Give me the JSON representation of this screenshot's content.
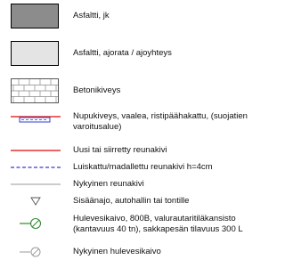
{
  "legend": {
    "items": [
      {
        "label": "Asfaltti, jk",
        "symbol": "dark-gray-fill-swatch",
        "color": "#8c8c8c"
      },
      {
        "label": "Asfaltti, ajorata / ajoyhteys",
        "symbol": "light-gray-fill-swatch",
        "color": "#e4e4e4"
      },
      {
        "label": "Betonikiveys",
        "symbol": "brick-pattern-swatch",
        "color": "#555555"
      },
      {
        "label_lines": [
          "Nupukiveys, vaalea, ristipäähakattu, (suojatien",
          "varoitusalue)"
        ],
        "symbol": "cobble-strip",
        "color": "#3b4fd6"
      },
      {
        "label": "Uusi tai siirretty reunakivi",
        "symbol": "red-solid-line",
        "color": "#e8312f"
      },
      {
        "label": "Luiskattu/madallettu reunakivi h=4cm",
        "symbol": "blue-dashed-line",
        "color": "#2c3fd1"
      },
      {
        "label": "Nykyinen reunakivi",
        "symbol": "gray-solid-line",
        "color": "#9a9a9a"
      },
      {
        "label": "Sisäänajo, autohallin tai tontille",
        "symbol": "down-triangle-icon",
        "color": "#555555"
      },
      {
        "label_lines": [
          "Hulevesikaivo, 800B, valurautaritiläkansisto",
          "(kantavuus 40 tn), sakkapesän tilavuus 300 L"
        ],
        "symbol": "new-drain-well-icon",
        "color": "#2f8a2f"
      },
      {
        "label": "Nykyinen hulevesikaivo",
        "symbol": "existing-drain-well-icon",
        "color": "#9a9a9a"
      }
    ]
  }
}
